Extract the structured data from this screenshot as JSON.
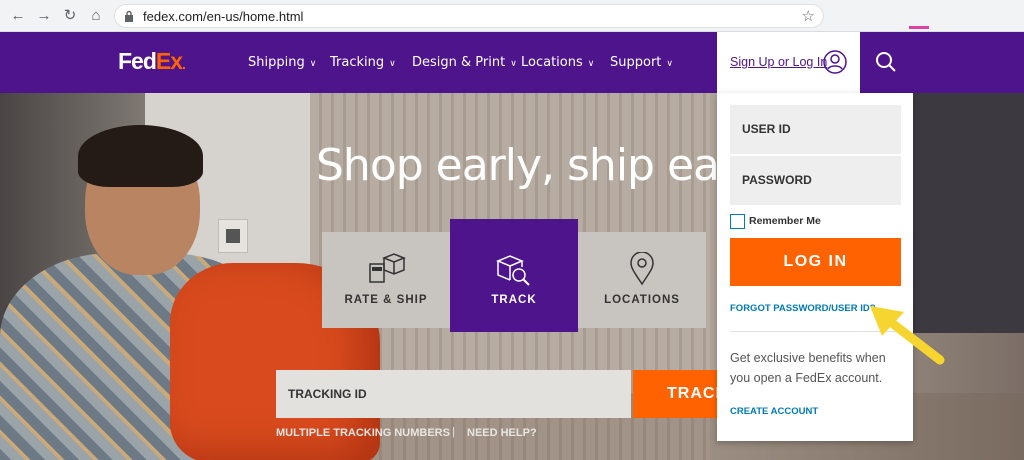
{
  "browser": {
    "url": "fedex.com/en-us/home.html"
  },
  "nav": {
    "logo_fed": "Fed",
    "logo_ex": "Ex",
    "logo_dot": ".",
    "items": [
      {
        "label": "Shipping"
      },
      {
        "label": "Tracking"
      },
      {
        "label": "Design & Print"
      },
      {
        "label": "Locations"
      },
      {
        "label": "Support"
      }
    ],
    "signin_label": "Sign Up or Log In"
  },
  "hero": {
    "headline": "Shop early, ship early",
    "tiles": [
      {
        "label": "RATE & SHIP",
        "icon": "rate-ship-icon"
      },
      {
        "label": "TRACK",
        "icon": "track-icon"
      },
      {
        "label": "LOCATIONS",
        "icon": "location-pin-icon"
      }
    ],
    "tracking_placeholder": "TRACKING ID",
    "track_button": "TRACK",
    "multi_tracking": "MULTIPLE TRACKING NUMBERS",
    "separator": "|",
    "need_help": "NEED HELP?"
  },
  "login": {
    "user_id_placeholder": "USER ID",
    "password_placeholder": "PASSWORD",
    "remember_me": "Remember Me",
    "login_button": "LOG IN",
    "forgot": "FORGOT PASSWORD/USER ID?",
    "benefits": "Get exclusive benefits when you open a FedEx account.",
    "create_account": "CREATE ACCOUNT"
  },
  "colors": {
    "fedex_purple": "#4d148c",
    "fedex_orange": "#ff6200",
    "link_blue": "#007ab7",
    "annotation_yellow": "#f7d531"
  }
}
